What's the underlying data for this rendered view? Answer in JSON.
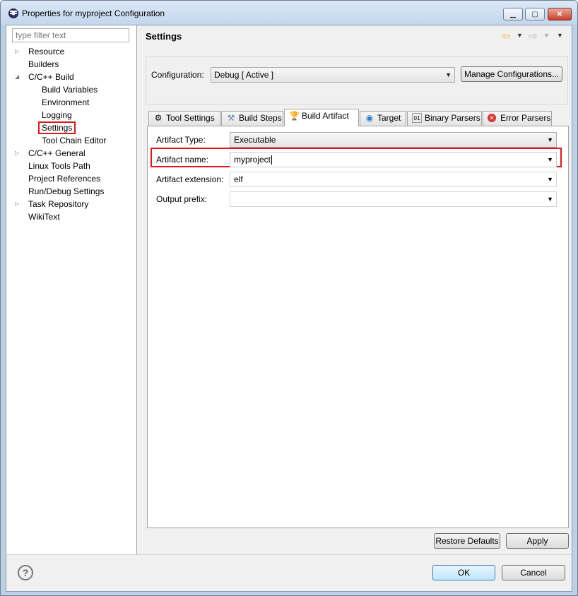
{
  "window": {
    "title": "Properties for myproject Configuration"
  },
  "left": {
    "filter_placeholder": "type filter text",
    "tree": [
      {
        "label": "Resource",
        "level": 0,
        "expander": "collapsed"
      },
      {
        "label": "Builders",
        "level": 0,
        "expander": "none"
      },
      {
        "label": "C/C++ Build",
        "level": 0,
        "expander": "expanded"
      },
      {
        "label": "Build Variables",
        "level": 1,
        "expander": "none"
      },
      {
        "label": "Environment",
        "level": 1,
        "expander": "none"
      },
      {
        "label": "Logging",
        "level": 1,
        "expander": "none"
      },
      {
        "label": "Settings",
        "level": 1,
        "expander": "none",
        "selected": true
      },
      {
        "label": "Tool Chain Editor",
        "level": 1,
        "expander": "none"
      },
      {
        "label": "C/C++ General",
        "level": 0,
        "expander": "collapsed"
      },
      {
        "label": "Linux Tools Path",
        "level": 0,
        "expander": "none"
      },
      {
        "label": "Project References",
        "level": 0,
        "expander": "none"
      },
      {
        "label": "Run/Debug Settings",
        "level": 0,
        "expander": "none"
      },
      {
        "label": "Task Repository",
        "level": 0,
        "expander": "collapsed"
      },
      {
        "label": "WikiText",
        "level": 0,
        "expander": "none"
      }
    ]
  },
  "right": {
    "page_title": "Settings",
    "configuration_label": "Configuration:",
    "configuration_value": "Debug  [ Active ]",
    "manage_button": "Manage Configurations...",
    "tabs": [
      {
        "label": "Tool Settings",
        "icon": "tool-settings-icon"
      },
      {
        "label": "Build Steps",
        "icon": "build-steps-icon"
      },
      {
        "label": "Build Artifact",
        "icon": "trophy-icon",
        "active": true
      },
      {
        "label": "Target",
        "icon": "globe-icon"
      },
      {
        "label": "Binary Parsers",
        "icon": "binary-icon"
      },
      {
        "label": "Error Parsers",
        "icon": "error-icon"
      }
    ],
    "fields": {
      "artifact_type_label": "Artifact Type:",
      "artifact_type_value": "Executable",
      "artifact_name_label": "Artifact name:",
      "artifact_name_value": "myproject",
      "artifact_ext_label": "Artifact extension:",
      "artifact_ext_value": "elf",
      "output_prefix_label": "Output prefix:",
      "output_prefix_value": ""
    },
    "restore_defaults": "Restore Defaults",
    "apply": "Apply"
  },
  "footer": {
    "ok": "OK",
    "cancel": "Cancel"
  },
  "colors": {
    "highlight": "#e0161a",
    "title_bar": "#c3d6ec"
  }
}
